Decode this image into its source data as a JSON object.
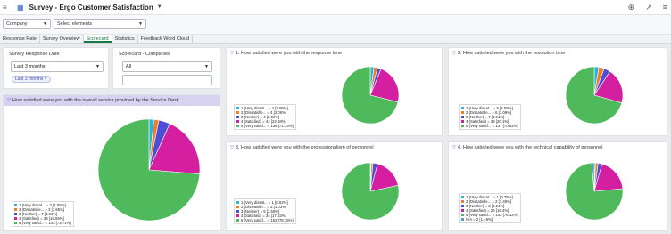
{
  "app": {
    "title": "Survey - Ergo Customer Satisfaction"
  },
  "filters": {
    "company_label": "Company",
    "elements_placeholder": "Select elements"
  },
  "tabs": [
    "Response Rate",
    "Survey Overview",
    "Scorecard",
    "Statistics",
    "Feedback Word Cloud"
  ],
  "active_tab": "Scorecard",
  "survey_response_date": {
    "title": "Survey Response Date",
    "selected": "Last 3 months",
    "chip": "Last 3 months"
  },
  "scorecard_companies": {
    "title": "Scorecard - Companies",
    "selected": "All",
    "search_value": ""
  },
  "colors": {
    "very_dissatisfied": "#2bb3d8",
    "dissatisfied": "#f07c2a",
    "neither": "#4b4fd6",
    "satisfied": "#d31fa0",
    "very_satisfied": "#4fba5b",
    "na": "#49a3b8"
  },
  "charts": {
    "overall": {
      "title": "How satisfied were you with the overall service provided by the Service Desk",
      "legend": [
        "1 (Very dissat... = 3 [1.55%]",
        "2 (Dissatisfie... = 3 [1.55%]",
        "3 (Neither) = 7 [3.61%]",
        "4 (Satisfied) = 38 [19.59%]",
        "5 (Very satisf... = 143 [73.71%]"
      ]
    },
    "response_time": {
      "title": "1. How satisfied were you with the response time",
      "legend": [
        "1 (Very dissat... = 4 [2.06%]",
        "2 (Dissatisfie... = 4 [2.06%]",
        "3 (Neither) = 4 [2.06%]",
        "4 (Satisfied) = 44 [22.68%]",
        "5 (Very satisf... = 138 [71.13%]"
      ]
    },
    "resolution_time": {
      "title": "2. How satisfied were you with the resolution time",
      "legend": [
        "1 (Very dissat... = 5 [2.58%]",
        "2 (Dissatisfie... = 6 [3.09%]",
        "3 (Neither) = 7 [3.61%]",
        "4 (Satisfied) = 39 [20.1%]",
        "5 (Very satisf... = 137 [70.62%]"
      ]
    },
    "professionalism": {
      "title": "3. How satisfied were you with the professionalism of personnel",
      "legend": [
        "1 (Very dissat... = 1 [0.52%]",
        "2 (Dissatisfie... = 2 [1.03%]",
        "3 (Neither) = 5 [2.58%]",
        "4 (Satisfied) = 34 [17.53%]",
        "5 (Very satisf... = 152 [78.35%]"
      ]
    },
    "technical": {
      "title": "4. How satisfied were you with the technical capability of personnel",
      "legend": [
        "1 (Very dissat... = 1 [0.75%]",
        "2 (Dissatisfie... = 2 [1.49%]",
        "3 (Neither) = 3 [2.24%]",
        "4 (Satisfied) = 26 [19.4%]",
        "5 (Very satisf... = 102 [76.12%]",
        "N/A = 2 [1.49%]"
      ]
    }
  },
  "chart_data": [
    {
      "type": "pie",
      "title": "How satisfied were you with the overall service provided by the Service Desk",
      "categories": [
        "1 (Very dissat...",
        "2 (Dissatisfie...",
        "3 (Neither)",
        "4 (Satisfied)",
        "5 (Very satisf..."
      ],
      "values": [
        3,
        3,
        7,
        38,
        143
      ]
    },
    {
      "type": "pie",
      "title": "1. How satisfied were you with the response time",
      "categories": [
        "1 (Very dissat...",
        "2 (Dissatisfie...",
        "3 (Neither)",
        "4 (Satisfied)",
        "5 (Very satisf..."
      ],
      "values": [
        4,
        4,
        4,
        44,
        138
      ]
    },
    {
      "type": "pie",
      "title": "2. How satisfied were you with the resolution time",
      "categories": [
        "1 (Very dissat...",
        "2 (Dissatisfie...",
        "3 (Neither)",
        "4 (Satisfied)",
        "5 (Very satisf..."
      ],
      "values": [
        5,
        6,
        7,
        39,
        137
      ]
    },
    {
      "type": "pie",
      "title": "3. How satisfied were you with the professionalism of personnel",
      "categories": [
        "1 (Very dissat...",
        "2 (Dissatisfie...",
        "3 (Neither)",
        "4 (Satisfied)",
        "5 (Very satisf..."
      ],
      "values": [
        1,
        2,
        5,
        34,
        152
      ]
    },
    {
      "type": "pie",
      "title": "4. How satisfied were you with the technical capability of personnel",
      "categories": [
        "1 (Very dissat...",
        "2 (Dissatisfie...",
        "3 (Neither)",
        "4 (Satisfied)",
        "5 (Very satisf...",
        "N/A"
      ],
      "values": [
        1,
        2,
        3,
        26,
        102,
        2
      ]
    }
  ]
}
